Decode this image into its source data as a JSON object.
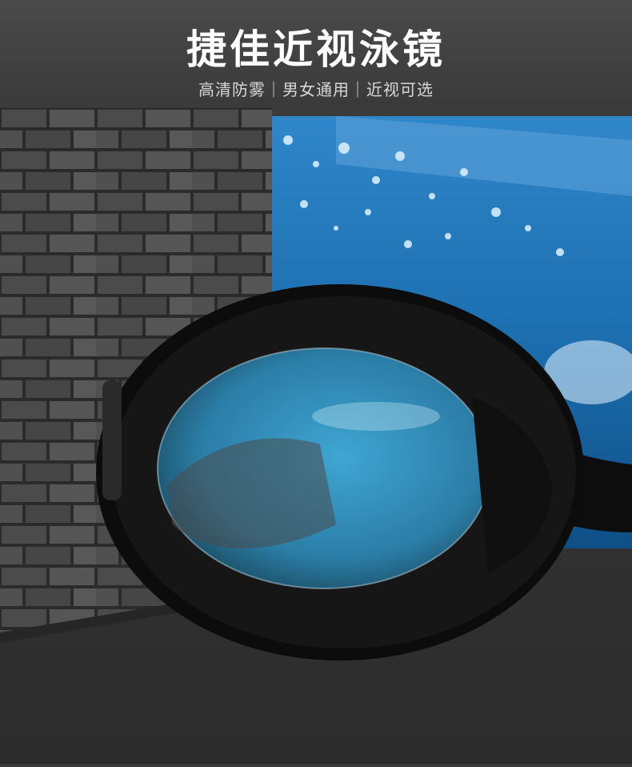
{
  "header": {
    "title": "捷佳近视泳镜",
    "subtitle": "高清防雾｜男女通用｜近视可选"
  },
  "colors": {
    "background": "#3a3a3a",
    "title_text": "#ffffff",
    "subtitle_text": "#d8d8d8",
    "water_blue": "#1f7fc2",
    "goggle_frame": "#0c0c0c"
  }
}
